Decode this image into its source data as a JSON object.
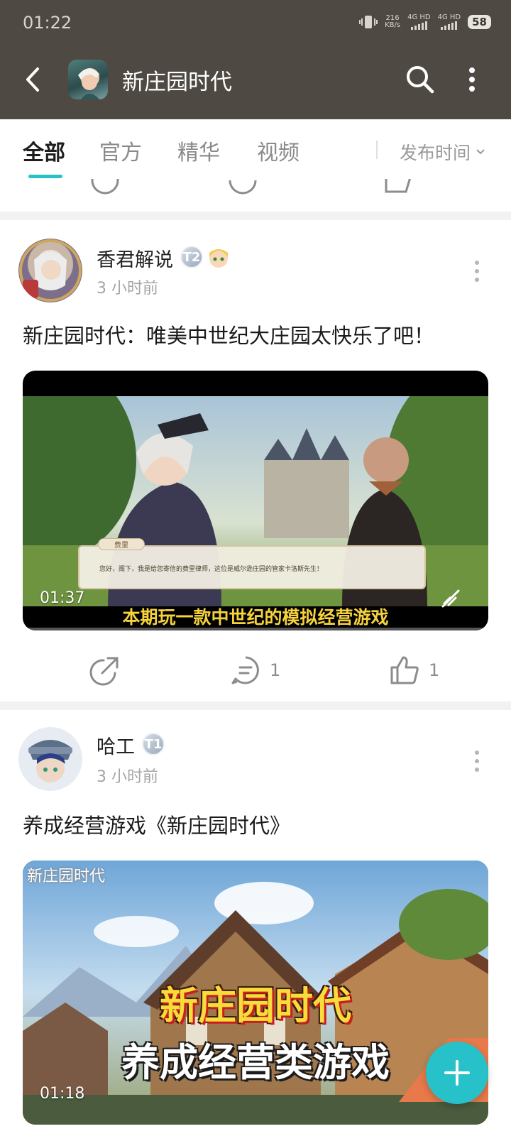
{
  "status_bar": {
    "time": "01:22",
    "net_speed_value": "216",
    "net_speed_unit": "KB/s",
    "sim1": "4G HD",
    "sim2": "4G HD",
    "battery": "58"
  },
  "header": {
    "title": "新庄园时代"
  },
  "tabs": [
    {
      "label": "全部"
    },
    {
      "label": "官方"
    },
    {
      "label": "精华"
    },
    {
      "label": "视频"
    }
  ],
  "sort": {
    "label": "发布时间"
  },
  "posts": [
    {
      "author": "香君解说",
      "badge": "T2",
      "time": "3 小时前",
      "title": "新庄园时代：唯美中世纪大庄园太快乐了吧！",
      "video_duration": "01:37",
      "video_caption": "本期玩一款中世纪的模拟经营游戏",
      "dialog_name": "费里",
      "dialog_text": "您好，阁下，我是给您寄信的费里律师，这位是威尔逊庄园的管家卡洛斯先生！",
      "comments": "1",
      "likes": "1"
    },
    {
      "author": "哈工",
      "badge": "T1",
      "time": "3 小时前",
      "title": "养成经营游戏《新庄园时代》",
      "video_duration": "01:18",
      "cover_logo": "新庄园时代",
      "cover_line1": "新庄园时代",
      "cover_line2": "养成经营类游戏"
    }
  ],
  "colors": {
    "header_bg": "#4e4942",
    "accent": "#27c1c9",
    "divider": "#f2f2f2"
  }
}
